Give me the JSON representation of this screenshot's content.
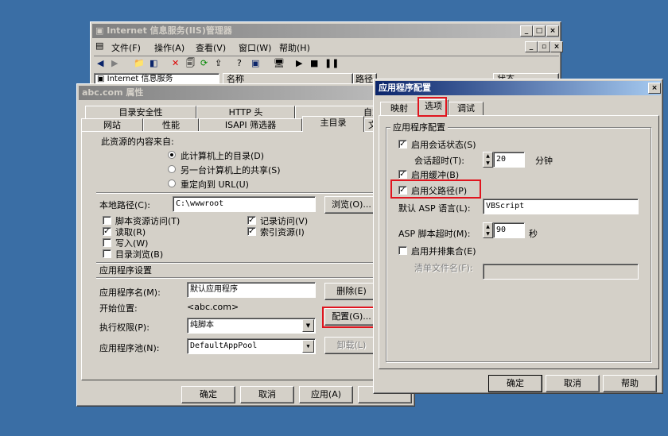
{
  "iis": {
    "title": "Internet 信息服务(IIS)管理器",
    "menu": [
      "文件(F)",
      "操作(A)",
      "查看(V)",
      "窗口(W)",
      "帮助(H)"
    ],
    "tree_root": "Internet 信息服务",
    "col_name": "名称",
    "col_path": "路径",
    "col_status": "状态"
  },
  "props": {
    "title": "abc.com 属性",
    "tabs_row1": [
      "目录安全性",
      "HTTP 头",
      "自定义错误"
    ],
    "tabs_row2": [
      "网站",
      "性能",
      "ISAPI 筛选器",
      "主目录",
      "文"
    ],
    "content_from": "此资源的内容来自:",
    "radio_local": "此计算机上的目录(D)",
    "radio_share": "另一台计算机上的共享(S)",
    "radio_redirect": "重定向到 URL(U)",
    "local_path_label": "本地路径(C):",
    "local_path_value": "C:\\wwwroot",
    "browse_label": "浏览(O)...",
    "chk_script_access": "脚本资源访问(T)",
    "chk_read": "读取(R)",
    "chk_write": "写入(W)",
    "chk_dir_browse": "目录浏览(B)",
    "chk_log": "记录访问(V)",
    "chk_index": "索引资源(I)",
    "app_settings": "应用程序设置",
    "app_name_label": "应用程序名(M):",
    "app_name_value": "默认应用程序",
    "remove_label": "删除(E)",
    "start_point_label": "开始位置:",
    "start_point_value": "<abc.com>",
    "config_label": "配置(G)...",
    "exec_perm_label": "执行权限(P):",
    "exec_perm_value": "纯脚本",
    "app_pool_label": "应用程序池(N):",
    "app_pool_value": "DefaultAppPool",
    "unload_label": "卸载(L)",
    "ok": "确定",
    "cancel": "取消",
    "apply": "应用(A)"
  },
  "appcfg": {
    "title": "应用程序配置",
    "tabs": [
      "映射",
      "选项",
      "调试"
    ],
    "group": "应用程序配置",
    "enable_session": "启用会话状态(S)",
    "session_timeout_label": "会话超时(T):",
    "session_timeout_value": "20",
    "minutes": "分钟",
    "enable_buffer": "启用缓冲(B)",
    "enable_parent_paths": "启用父路径(P)",
    "default_lang_label": "默认 ASP 语言(L):",
    "default_lang_value": "VBScript",
    "script_timeout_label": "ASP 脚本超时(M):",
    "script_timeout_value": "90",
    "seconds": "秒",
    "enable_side_by_side": "启用并排集合(E)",
    "manifest_label": "清单文件名(F):",
    "manifest_value": "",
    "ok": "确定",
    "cancel": "取消",
    "help": "帮助"
  }
}
